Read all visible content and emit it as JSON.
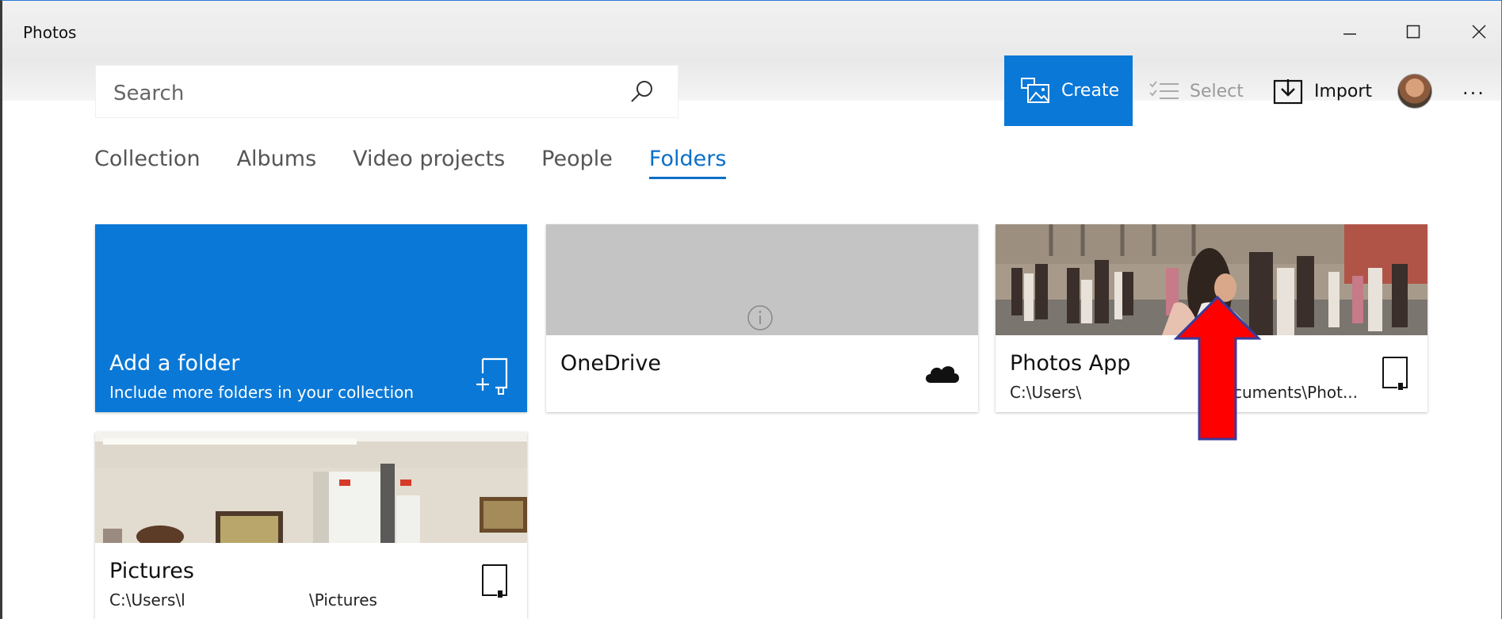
{
  "app": {
    "title": "Photos"
  },
  "window_controls": {
    "minimize_icon": "minimize-icon",
    "maximize_icon": "maximize-icon",
    "close_icon": "close-icon"
  },
  "search": {
    "placeholder": "Search",
    "icon": "search-icon"
  },
  "toolbar": {
    "create_label": "Create",
    "select_label": "Select",
    "import_label": "Import",
    "more_label": "...",
    "accent": "#0A78D7"
  },
  "tabs": [
    {
      "label": "Collection",
      "active": false
    },
    {
      "label": "Albums",
      "active": false
    },
    {
      "label": "Video projects",
      "active": false
    },
    {
      "label": "People",
      "active": false
    },
    {
      "label": "Folders",
      "active": true
    }
  ],
  "folders": {
    "add": {
      "title": "Add a folder",
      "subtitle": "Include more folders in your collection",
      "icon": "add-folder-icon"
    },
    "onedrive": {
      "title": "OneDrive",
      "subtitle": "",
      "icon": "cloud-icon",
      "thumb_icon": "info-icon"
    },
    "photos_app": {
      "title": "Photos App",
      "path_start": "C:\\Users\\",
      "path_end": "cuments\\Phot...",
      "icon": "device-icon"
    },
    "pictures": {
      "title": "Pictures",
      "path_start": "C:\\Users\\l",
      "path_end": "\\Pictures",
      "icon": "device-icon"
    }
  },
  "annotation": {
    "icon": "red-arrow-icon",
    "color": "#FF0000"
  }
}
